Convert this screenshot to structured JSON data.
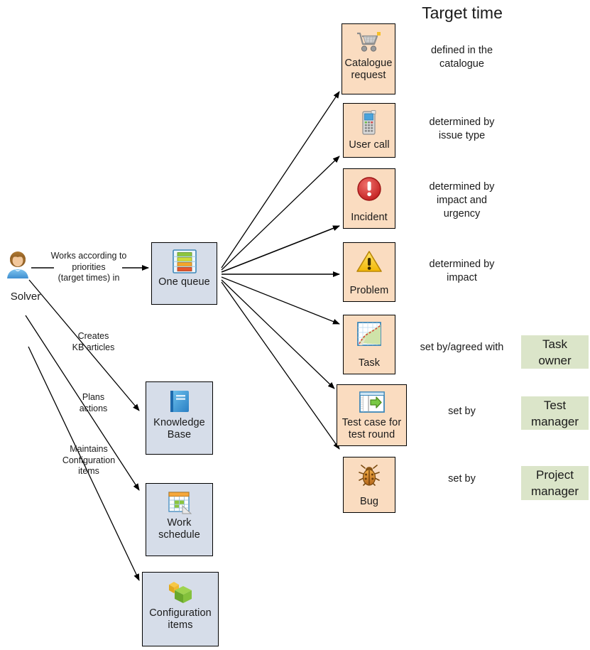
{
  "diagram": {
    "title": "Target time",
    "actor": {
      "name": "Solver",
      "icon": "user-avatar-icon"
    },
    "edge_labels": [
      {
        "id": "works-according-to",
        "text": "Works according to\npriorities\n(target times) in"
      },
      {
        "id": "creates-kb-articles",
        "text": "Creates\nKB articles"
      },
      {
        "id": "plans-actions",
        "text": "Plans\nactions"
      },
      {
        "id": "maintains-configuration-items",
        "text": "Maintains\nConfiguration\nitems"
      }
    ],
    "blue_nodes": [
      {
        "id": "one-queue",
        "label": "One queue",
        "icon": "queue-stack-icon"
      },
      {
        "id": "knowledge-base",
        "label": "Knowledge\nBase",
        "icon": "book-icon"
      },
      {
        "id": "work-schedule",
        "label": "Work\nschedule",
        "icon": "calendar-icon"
      },
      {
        "id": "configuration-items",
        "label": "Configuration\nitems",
        "icon": "cubes-icon"
      }
    ],
    "orange_nodes": [
      {
        "id": "catalogue-request",
        "label": "Catalogue\nrequest",
        "icon": "shopping-cart-icon"
      },
      {
        "id": "user-call",
        "label": "User call",
        "icon": "mobile-phone-icon"
      },
      {
        "id": "incident",
        "label": "Incident",
        "icon": "red-exclamation-icon"
      },
      {
        "id": "problem",
        "label": "Problem",
        "icon": "yellow-warning-triangle-icon"
      },
      {
        "id": "task",
        "label": "Task",
        "icon": "map-task-icon"
      },
      {
        "id": "test-case",
        "label": "Test case for\ntest round",
        "icon": "test-run-icon"
      },
      {
        "id": "bug",
        "label": "Bug",
        "icon": "bug-icon"
      }
    ],
    "target_time_rules": [
      {
        "id": "rule-catalogue-request",
        "text": "defined in the\ncatalogue"
      },
      {
        "id": "rule-user-call",
        "text": "determined by\nissue type"
      },
      {
        "id": "rule-incident",
        "text": "determined by\nimpact and\nurgency"
      },
      {
        "id": "rule-problem",
        "text": "determined by\nimpact"
      },
      {
        "id": "rule-task",
        "text": "set by/agreed with"
      },
      {
        "id": "rule-test-case",
        "text": "set by"
      },
      {
        "id": "rule-bug",
        "text": "set by"
      }
    ],
    "roles": [
      {
        "id": "task-owner",
        "label": "Task\nowner"
      },
      {
        "id": "test-manager",
        "label": "Test\nmanager"
      },
      {
        "id": "project-manager",
        "label": "Project\nmanager"
      }
    ],
    "colors": {
      "blue_fill": "#d6dde9",
      "orange_fill": "#fadcc0",
      "green_fill": "#dbe5c9",
      "border": "#000000",
      "text": "#1a1a1a"
    }
  }
}
